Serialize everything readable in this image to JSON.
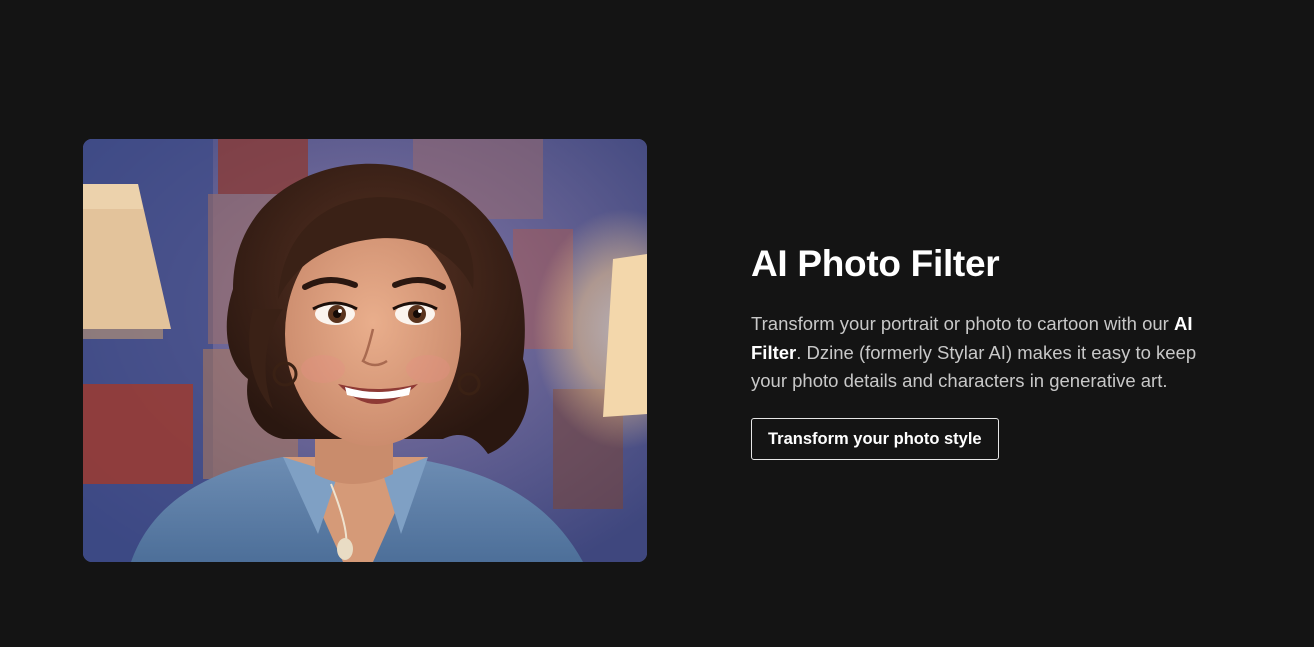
{
  "hero": {
    "image_alt": "3D cartoon-style portrait of a smiling woman with short curly brown hair wearing a denim shirt"
  },
  "feature": {
    "title": "AI Photo Filter",
    "description_part1": "Transform your portrait or photo to cartoon with our ",
    "description_bold": "AI Filter",
    "description_part2": ". Dzine (formerly Stylar AI) makes it easy to keep your photo details and characters in generative art.",
    "cta_label": "Transform your photo style"
  },
  "colors": {
    "background": "#141414",
    "title": "#ffffff",
    "body_text": "#c8c8c8",
    "button_border": "#e6e6e6"
  }
}
